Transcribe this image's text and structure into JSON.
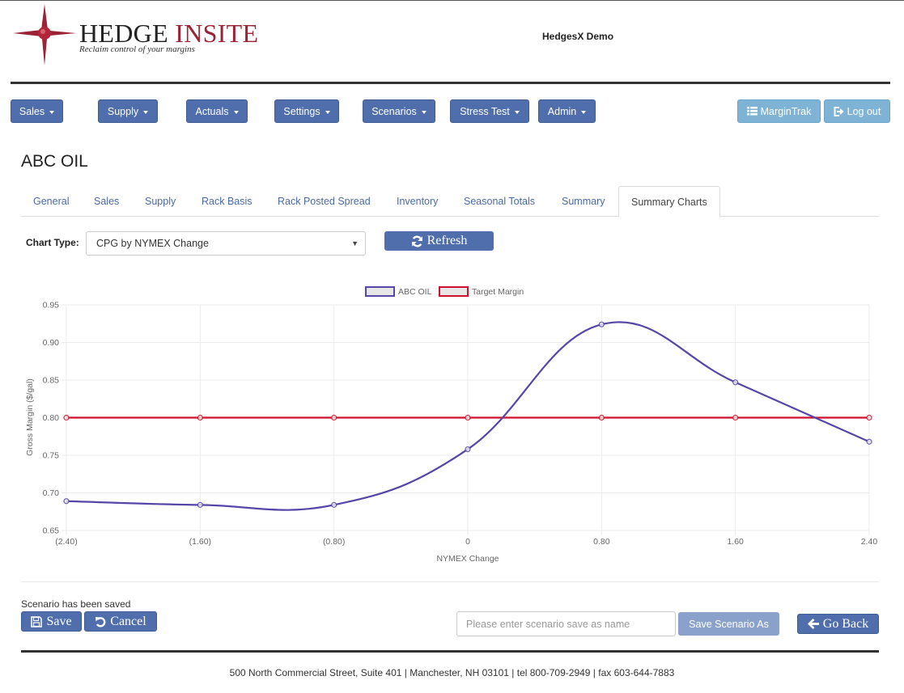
{
  "header": {
    "logo_word1": "HEDGE",
    "logo_word2": "INSITE",
    "logo_tagline": "Reclaim control of your margins",
    "app_name": "HedgesX Demo"
  },
  "nav": {
    "menus": [
      {
        "label": "Sales"
      },
      {
        "label": "Supply"
      },
      {
        "label": "Actuals"
      },
      {
        "label": "Settings"
      },
      {
        "label": "Scenarios"
      },
      {
        "label": "Stress Test"
      },
      {
        "label": "Admin"
      }
    ],
    "margintrak_label": "MarginTrak",
    "logout_label": "Log out"
  },
  "page": {
    "title": "ABC OIL",
    "tabs": [
      {
        "label": "General"
      },
      {
        "label": "Sales"
      },
      {
        "label": "Supply"
      },
      {
        "label": "Rack Basis"
      },
      {
        "label": "Rack Posted Spread"
      },
      {
        "label": "Inventory"
      },
      {
        "label": "Seasonal Totals"
      },
      {
        "label": "Summary"
      },
      {
        "label": "Summary Charts",
        "active": true
      }
    ],
    "chart_type_label": "Chart Type:",
    "chart_type_value": "CPG by NYMEX Change",
    "refresh_label": "Refresh"
  },
  "chart_data": {
    "type": "line",
    "title": "",
    "xlabel": "NYMEX Change",
    "ylabel": "Gross Margin ($/gal)",
    "categories": [
      "(2.40)",
      "(1.60)",
      "(0.80)",
      "0",
      "0.80",
      "1.60",
      "2.40"
    ],
    "ylim": [
      0.65,
      0.95
    ],
    "yticks": [
      "0.65",
      "0.70",
      "0.75",
      "0.80",
      "0.85",
      "0.90",
      "0.95"
    ],
    "grid": true,
    "legend_position": "top-center",
    "series": [
      {
        "name": "ABC OIL",
        "color": "#5546a8",
        "smooth": true,
        "values": [
          0.689,
          0.684,
          0.684,
          0.758,
          0.924,
          0.847,
          0.768
        ]
      },
      {
        "name": "Target Margin",
        "color": "#d0112b",
        "smooth": false,
        "values": [
          0.8,
          0.8,
          0.8,
          0.8,
          0.8,
          0.8,
          0.8
        ]
      }
    ]
  },
  "actions": {
    "status_message": "Scenario has been saved",
    "save_label": "Save",
    "cancel_label": "Cancel",
    "save_as_placeholder": "Please enter scenario save as name",
    "save_as_value": "",
    "save_as_button": "Save Scenario As",
    "go_back_label": "Go Back"
  },
  "footer": {
    "address": "500 North Commercial Street, Suite 401 | Manchester, NH 03101 | tel 800-709-2949 | fax 603-644-7883"
  }
}
